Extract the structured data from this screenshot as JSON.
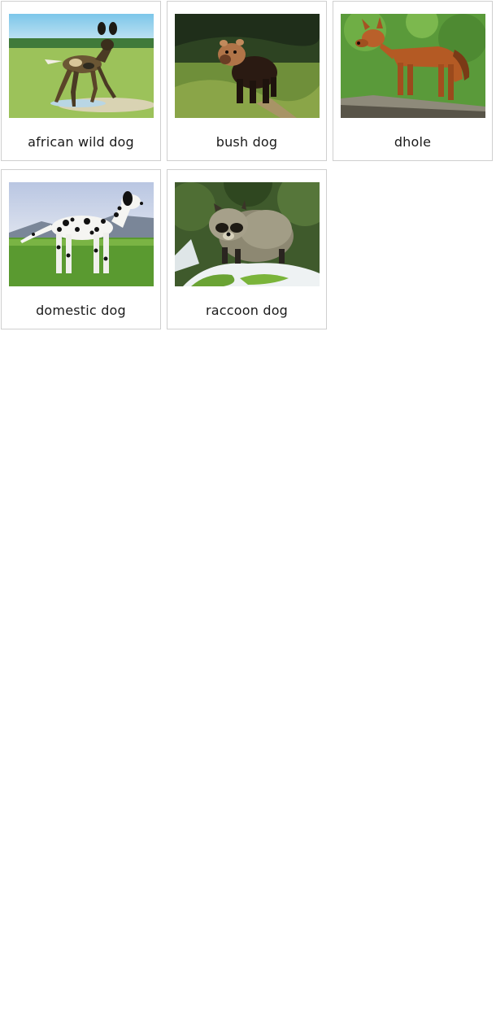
{
  "cards": [
    {
      "label": "african wild dog",
      "image": "african-wild-dog-photo"
    },
    {
      "label": "bush dog",
      "image": "bush-dog-photo"
    },
    {
      "label": "dhole",
      "image": "dhole-photo"
    },
    {
      "label": "domestic dog",
      "image": "dalmatian-photo"
    },
    {
      "label": "raccoon dog",
      "image": "raccoon-dog-photo"
    }
  ]
}
